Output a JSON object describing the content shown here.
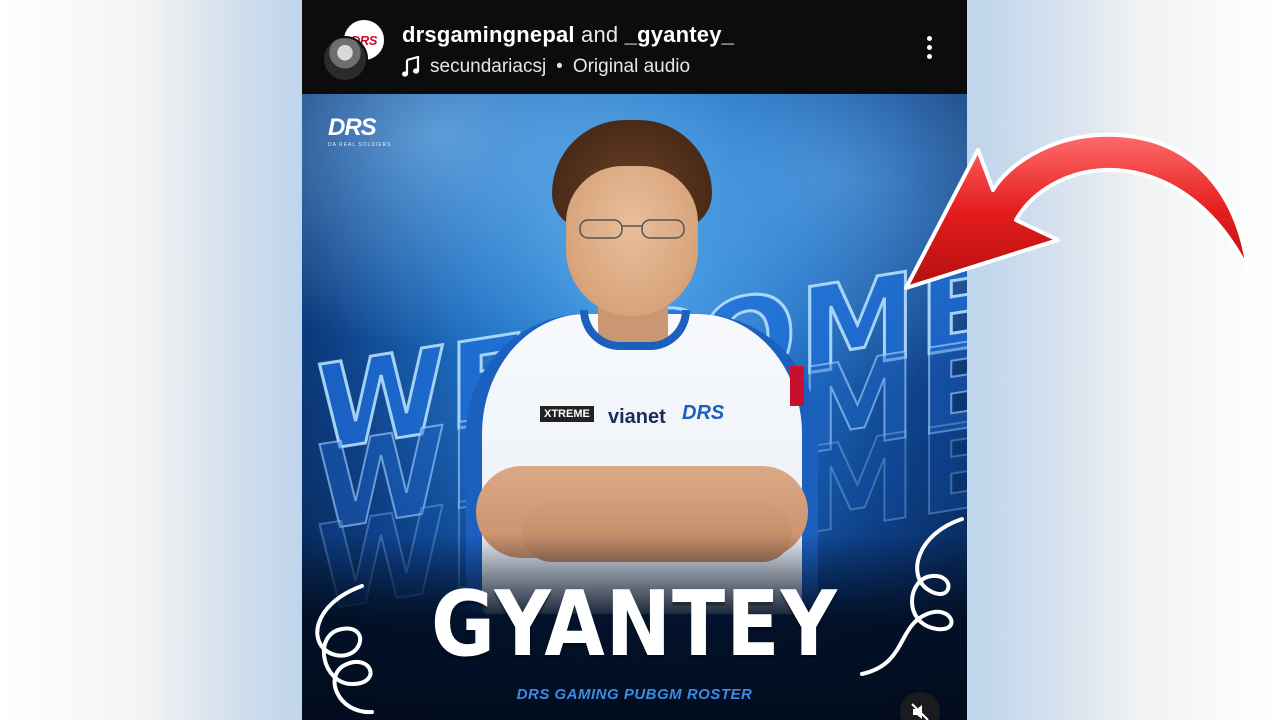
{
  "post": {
    "author_primary": "drsgamingnepal",
    "connector": "and",
    "author_secondary": "_gyantey_",
    "audio_user": "secundariacsj",
    "audio_separator": "•",
    "audio_label": "Original audio",
    "avatar_badge": "DRS"
  },
  "poster": {
    "logo_mark": "DRS",
    "logo_tagline": "DA REAL SOLDIERS",
    "headline_rows": [
      "WELCOME BACK",
      "WELCOME BACK",
      "WELCOME BACK"
    ],
    "player_name": "GYANTEY",
    "subtitle": "DRS GAMING PUBGM ROSTER",
    "sponsors": [
      "XTREME",
      "vianet",
      "DRS"
    ]
  },
  "icons": {
    "more": "more-vertical-icon",
    "music": "music-note-icon",
    "mute": "volume-muted-icon",
    "arrow": "red-curved-arrow"
  },
  "colors": {
    "accent_blue": "#1b5fbf",
    "header_bg": "#0c0c0c",
    "arrow_red": "#e02020"
  }
}
